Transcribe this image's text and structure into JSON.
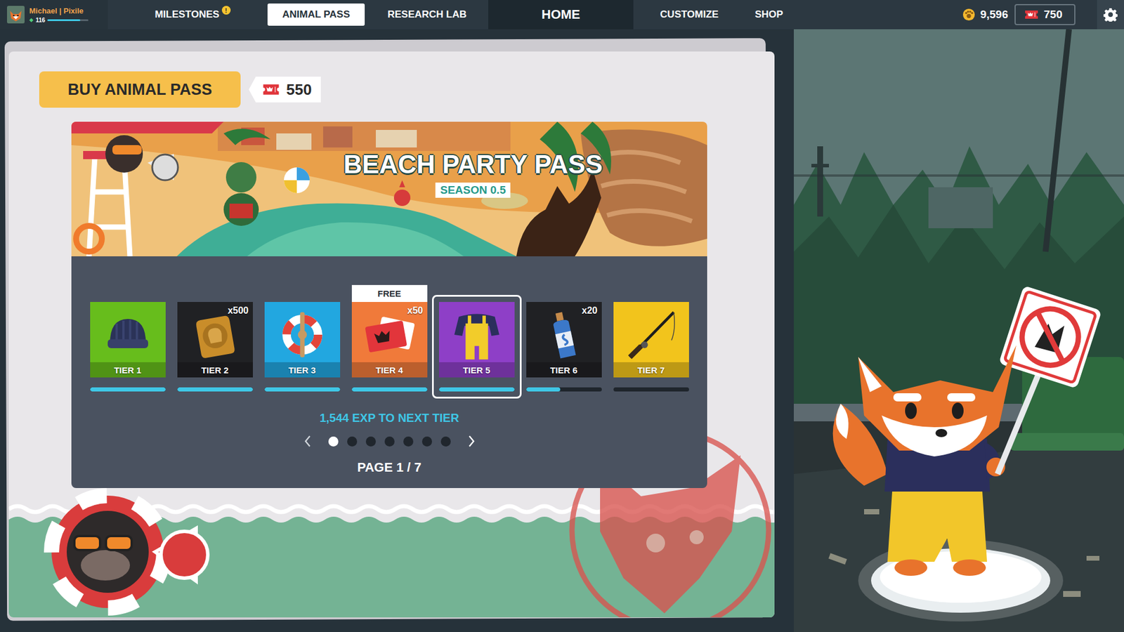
{
  "player": {
    "name": "Michael | Pixile",
    "level": "116",
    "xp": 0.8
  },
  "tabs": [
    {
      "label": "MILESTONES",
      "selected": false,
      "kind": "tab",
      "badge": "!"
    },
    {
      "label": "ANIMAL PASS",
      "selected": true,
      "kind": "tab"
    },
    {
      "label": "RESEARCH LAB",
      "selected": false,
      "kind": "tab"
    },
    {
      "label": "HOME",
      "selected": false,
      "kind": "home"
    },
    {
      "label": "CUSTOMIZE",
      "selected": false,
      "kind": "tab"
    },
    {
      "label": "SHOP",
      "selected": false,
      "kind": "tab"
    }
  ],
  "currency": {
    "coins": "9,596",
    "tickets": "750"
  },
  "pass": {
    "buy_button": "BUY ANIMAL PASS",
    "price": "550",
    "banner_title": "BEACH PARTY PASS",
    "banner_season": "SEASON 0.5",
    "exp_to_next": "1,544 EXP TO NEXT TIER",
    "page_label": "PAGE 1 / 7"
  },
  "tiers": [
    {
      "label": "TIER 1",
      "kind": "beanie",
      "color": "#67bd1c",
      "level": 1,
      "selected": false
    },
    {
      "label": "TIER 2",
      "kind": "coins",
      "color": "#202124",
      "count": "x500",
      "level": 1,
      "selected": false
    },
    {
      "label": "TIER 3",
      "kind": "ring",
      "color": "#22a7e0",
      "level": 1,
      "selected": false
    },
    {
      "label": "TIER 4",
      "kind": "tickets",
      "color": "#f07a3a",
      "count": "x50",
      "tag": "FREE",
      "level": 1,
      "selected": false
    },
    {
      "label": "TIER 5",
      "kind": "overalls",
      "color": "#8e3fc7",
      "level": 1,
      "selected": true
    },
    {
      "label": "TIER 6",
      "kind": "bottle",
      "color": "#202124",
      "count": "x20",
      "level": 0.45,
      "selected": false
    },
    {
      "label": "TIER 7",
      "kind": "rod",
      "color": "#f2c41c",
      "level": 0,
      "selected": false
    }
  ],
  "pages": [
    {
      "selected": true
    },
    {
      "selected": false
    },
    {
      "selected": false
    },
    {
      "selected": false
    },
    {
      "selected": false
    },
    {
      "selected": false
    },
    {
      "selected": false
    }
  ]
}
